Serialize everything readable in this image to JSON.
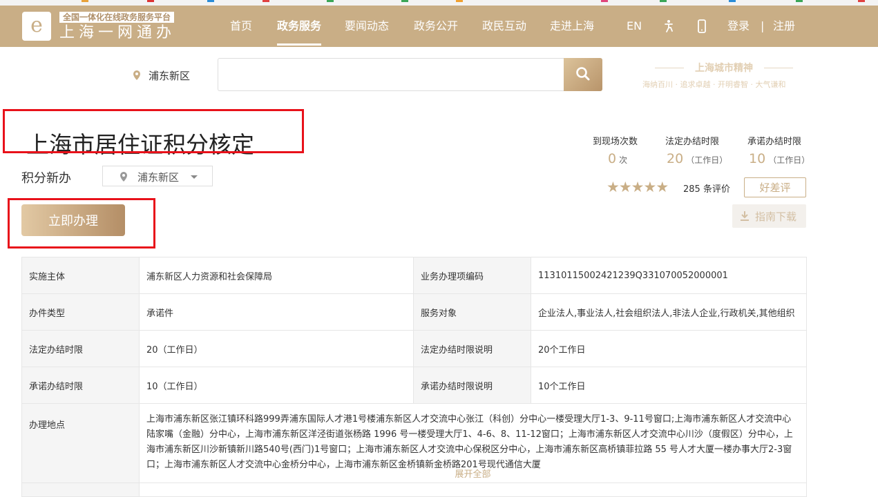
{
  "header": {
    "logo_tag": "全国一体化在线政务服务平台",
    "logo_title": "上海一网通办",
    "nav": [
      "首页",
      "政务服务",
      "要闻动态",
      "政务公开",
      "政民互动",
      "走进上海"
    ],
    "active_nav": "政务服务",
    "lang": "EN",
    "login": "登录",
    "separator": "|",
    "register": "注册",
    "accent_color": "#c9ae86"
  },
  "search": {
    "location": "浦东新区",
    "placeholder": "",
    "spirit_title": "上海城市精神",
    "spirit_sub": "海纳百川 · 追求卓越 · 开明睿智 · 大气谦和"
  },
  "service": {
    "title": "上海市居住证积分核定",
    "sub_type": "积分新办",
    "area": "浦东新区",
    "apply_label": "立即办理",
    "stats": [
      {
        "label": "到现场次数",
        "value": "0",
        "unit": "次"
      },
      {
        "label": "法定办结时限",
        "value": "20",
        "unit": "（工作日）"
      },
      {
        "label": "承诺办结时限",
        "value": "10",
        "unit": "（工作日）"
      }
    ],
    "rating_stars": 5,
    "rating_count": "285 条评价",
    "review_label": "好差评",
    "guide_label": "指南下载"
  },
  "table": {
    "rows": [
      {
        "k1": "实施主体",
        "v1": "浦东新区人力资源和社会保障局",
        "k2": "业务办理项编码",
        "v2": "11310115002421239Q331070052000001"
      },
      {
        "k1": "办件类型",
        "v1": "承诺件",
        "k2": "服务对象",
        "v2": "企业法人,事业法人,社会组织法人,非法人企业,行政机关,其他组织"
      },
      {
        "k1": "法定办结时限",
        "v1": "20（工作日）",
        "k2": "法定办结时限说明",
        "v2": "20个工作日"
      },
      {
        "k1": "承诺办结时限",
        "v1": "10（工作日）",
        "k2": "承诺办结时限说明",
        "v2": "10个工作日"
      }
    ],
    "address_key": "办理地点",
    "address_value": "上海市浦东新区张江镇环科路999弄浦东国际人才港1号楼浦东新区人才交流中心张江（科创）分中心一楼受理大厅1-3、9-11号窗口;上海市浦东新区人才交流中心陆家嘴（金融）分中心，上海市浦东新区洋泾街道张杨路 1996 号一楼受理大厅1、4-6、8、11-12窗口；上海市浦东新区人才交流中心川沙（度假区）分中心，上海市浦东新区川沙新镇新川路540号(西门)1号窗口；上海市浦东新区人才交流中心保税区分中心，上海市浦东新区高桥镇菲拉路 55 号人才大厦一楼办事大厅2-3窗口；上海市浦东新区人才交流中心金桥分中心，上海市浦东新区金桥镇新金桥路201号现代通信大厦",
    "expand_label": "展开全部"
  }
}
